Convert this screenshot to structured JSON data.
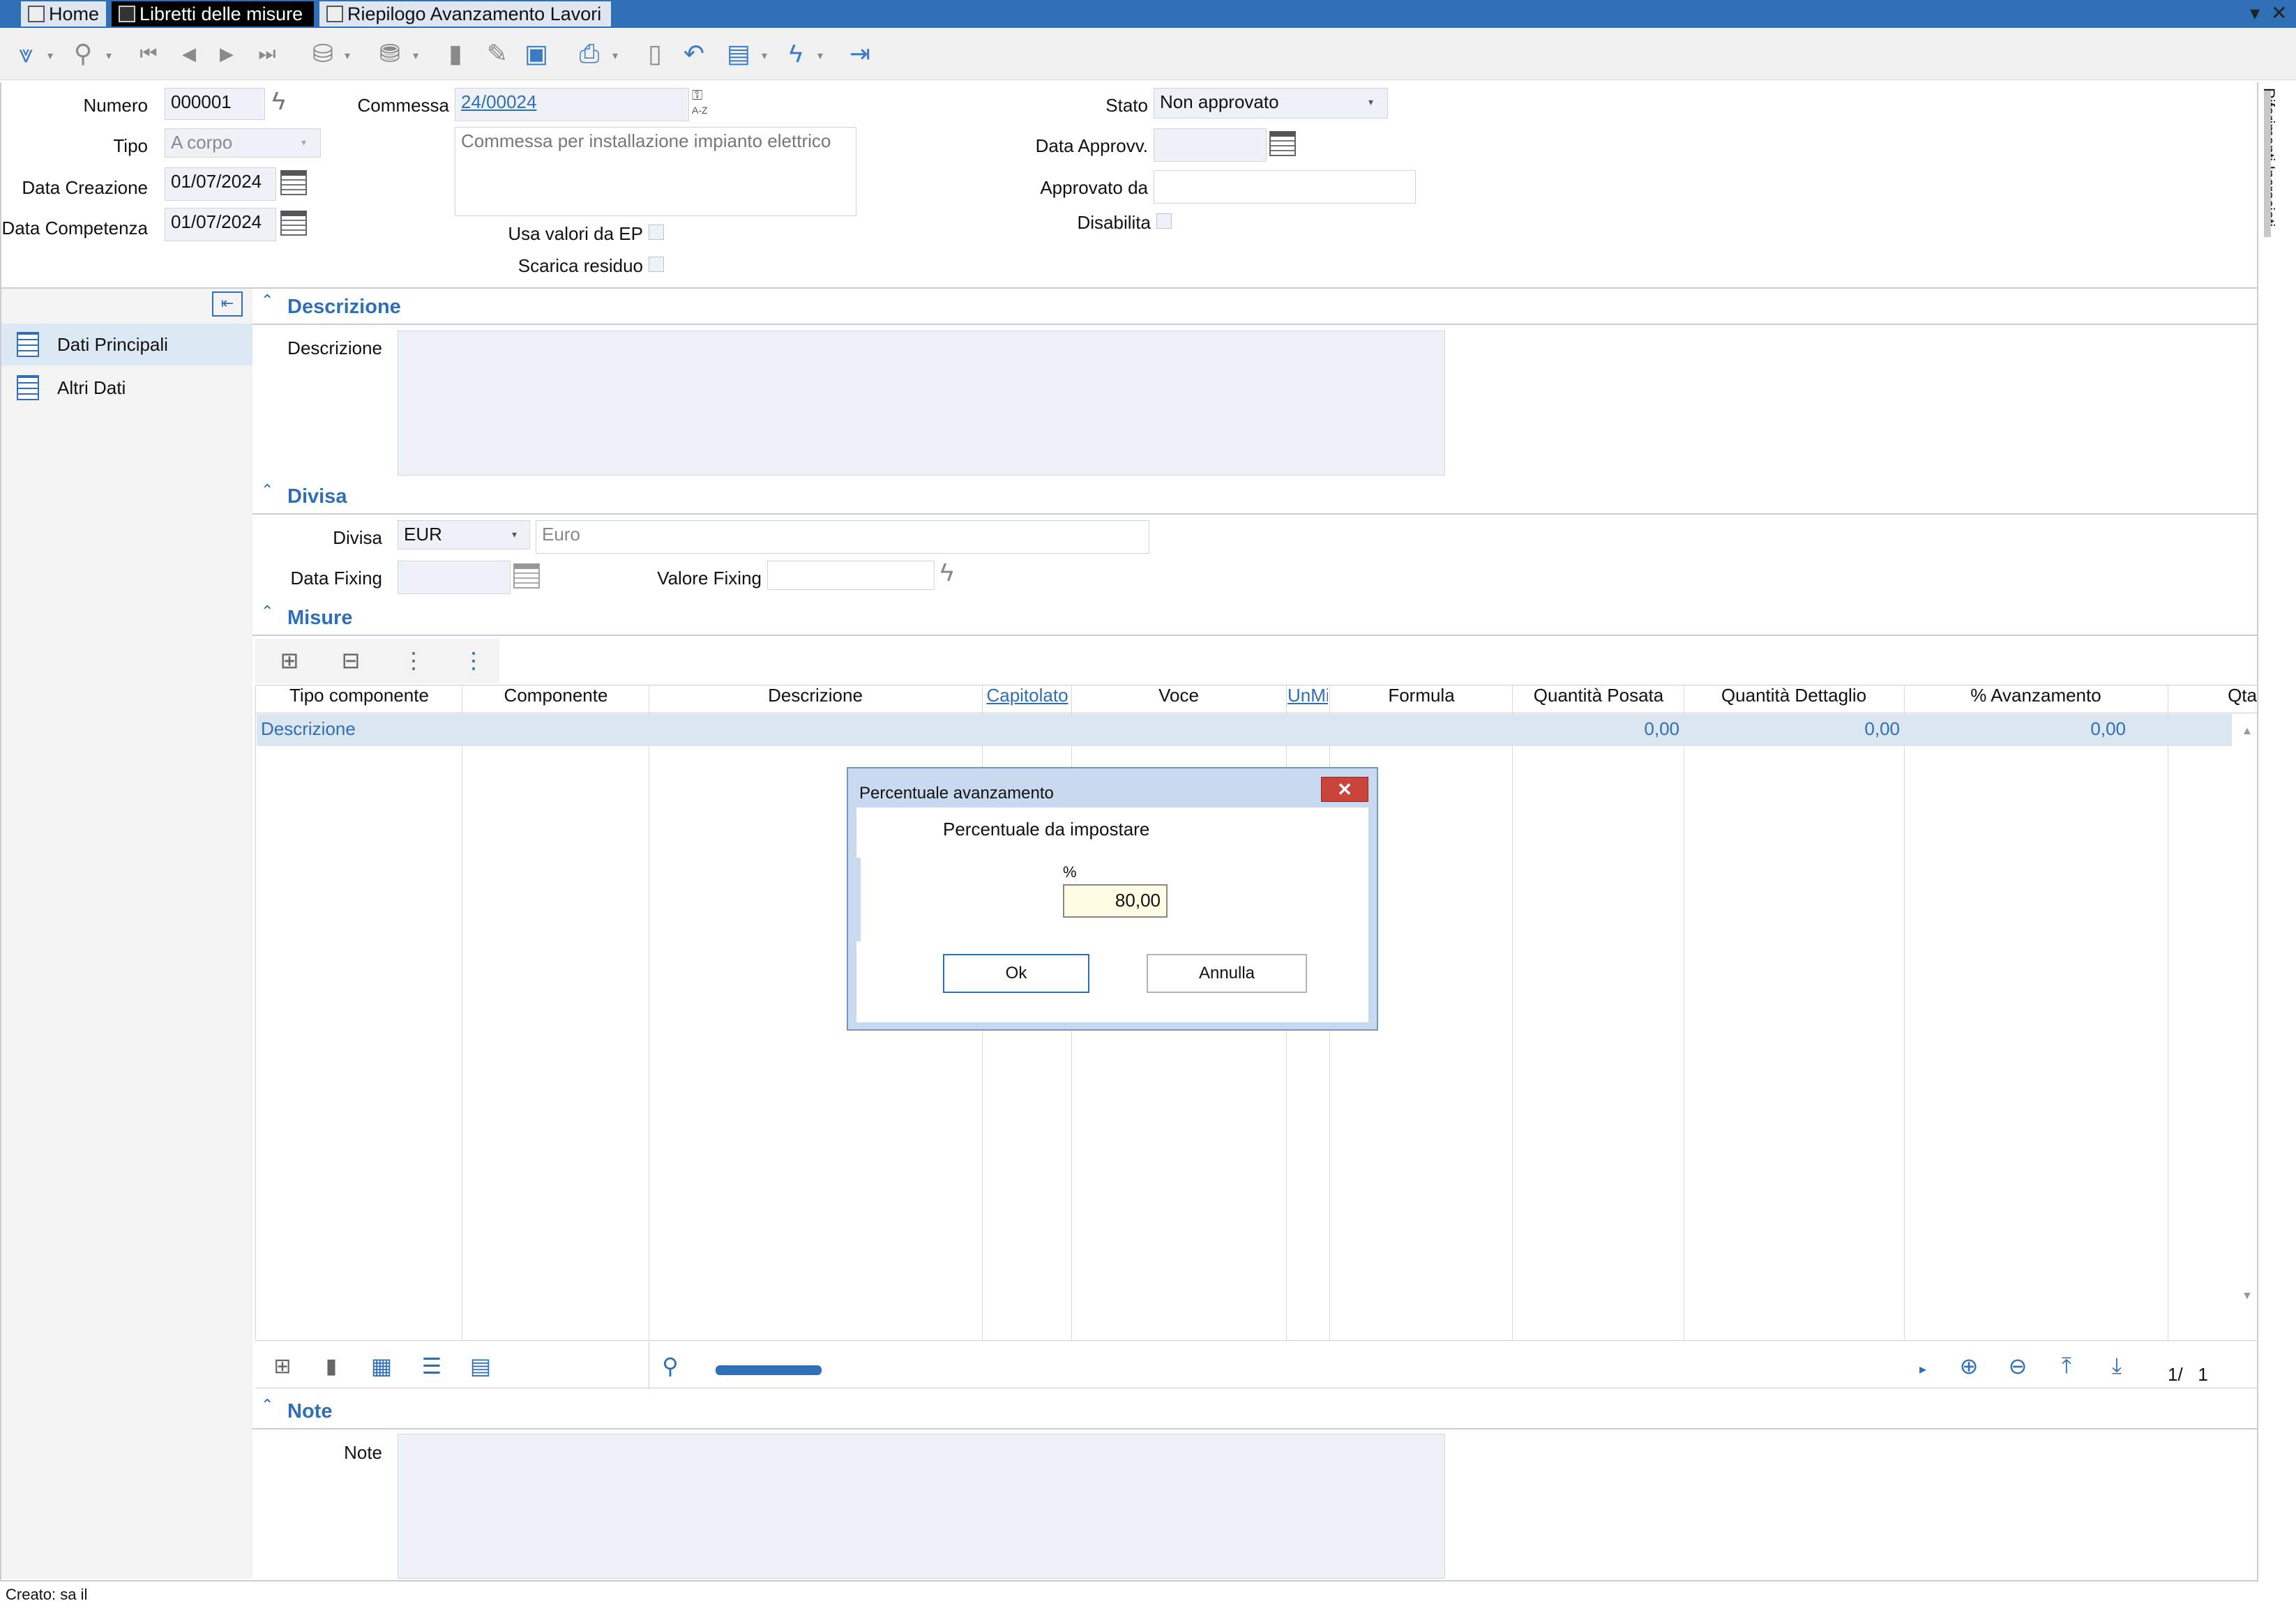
{
  "tabs": [
    {
      "label": "Home"
    },
    {
      "label": "Libretti delle misure"
    },
    {
      "label": "Riepilogo Avanzamento Lavori"
    }
  ],
  "window_controls": {
    "collapse": "▾",
    "close": "✕"
  },
  "toolbar": {
    "icons": [
      "expand-menu-icon",
      "search-icon",
      "first-record-icon",
      "previous-record-icon",
      "next-record-icon",
      "last-record-icon",
      "satellite-icon",
      "database-icon",
      "new-document-icon",
      "edit-icon",
      "save-icon",
      "print-icon",
      "delete-icon",
      "undo-icon",
      "report-icon",
      "action-lightning-icon",
      "exit-icon"
    ]
  },
  "header": {
    "numero_label": "Numero",
    "numero_value": "000001",
    "tipo_label": "Tipo",
    "tipo_value": "A corpo",
    "data_creazione_label": "Data Creazione",
    "data_creazione_value": "01/07/2024",
    "data_competenza_label": "Data Competenza",
    "data_competenza_value": "01/07/2024",
    "commessa_label": "Commessa",
    "commessa_value": "24/00024",
    "commessa_desc": "Commessa per installazione impianto elettrico",
    "az_label": "A-Z",
    "usa_valori_label": "Usa valori da EP",
    "scarica_residuo_label": "Scarica residuo",
    "stato_label": "Stato",
    "stato_value": "Non approvato",
    "data_approvv_label": "Data Approvv.",
    "approvato_da_label": "Approvato da",
    "disabilita_label": "Disabilita",
    "side_panel_label": "Riferimenti Incrociati"
  },
  "nav": {
    "items": [
      {
        "label": "Dati Principali",
        "selected": true
      },
      {
        "label": "Altri Dati",
        "selected": false
      }
    ]
  },
  "sections": {
    "descrizione": {
      "title": "Descrizione",
      "field_label": "Descrizione"
    },
    "divisa": {
      "title": "Divisa",
      "divisa_label": "Divisa",
      "divisa_value": "EUR",
      "divisa_desc": "Euro",
      "data_fixing_label": "Data Fixing",
      "valore_fixing_label": "Valore Fixing"
    },
    "misure": {
      "title": "Misure"
    },
    "note": {
      "title": "Note",
      "field_label": "Note"
    }
  },
  "grid": {
    "columns": [
      "Tipo componente",
      "Componente",
      "Descrizione",
      "Capitolato",
      "Voce",
      "UnMis",
      "Formula",
      "Quantità Posata",
      "Quantità Dettaglio",
      "% Avanzamento",
      "Qta"
    ],
    "row": {
      "tipo": "Descrizione",
      "qposata": "0,00",
      "qdettaglio": "0,00",
      "avanz": "0,00"
    },
    "pager": "1/   1"
  },
  "dialog": {
    "title": "Percentuale avanzamento",
    "prompt": "Percentuale da impostare",
    "field_label": "%",
    "value": "80,00",
    "ok_label": "Ok",
    "cancel_label": "Annulla"
  },
  "status_bar": {
    "text": "Creato: sa il"
  }
}
